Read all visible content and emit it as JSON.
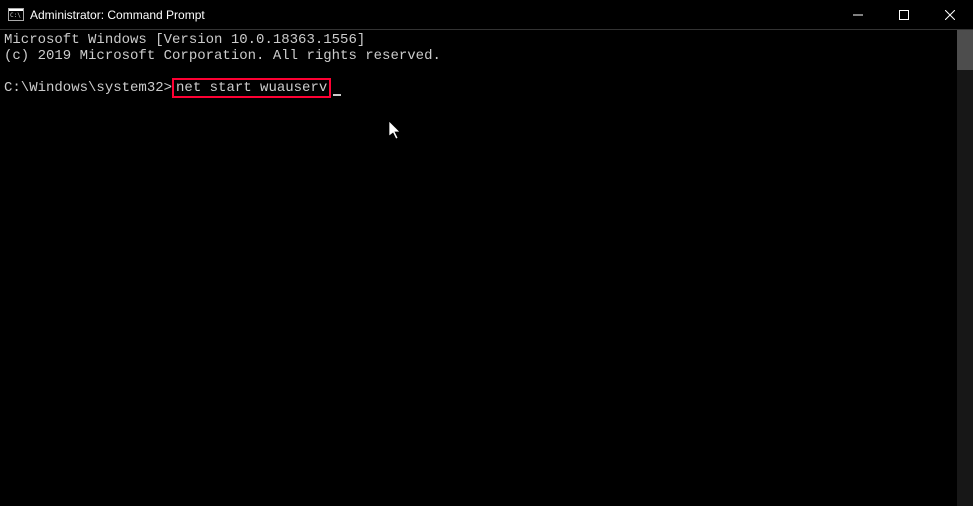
{
  "window": {
    "title": "Administrator: Command Prompt"
  },
  "terminal": {
    "line1": "Microsoft Windows [Version 10.0.18363.1556]",
    "line2": "(c) 2019 Microsoft Corporation. All rights reserved.",
    "prompt": "C:\\Windows\\system32>",
    "command": "net start wuauserv"
  }
}
